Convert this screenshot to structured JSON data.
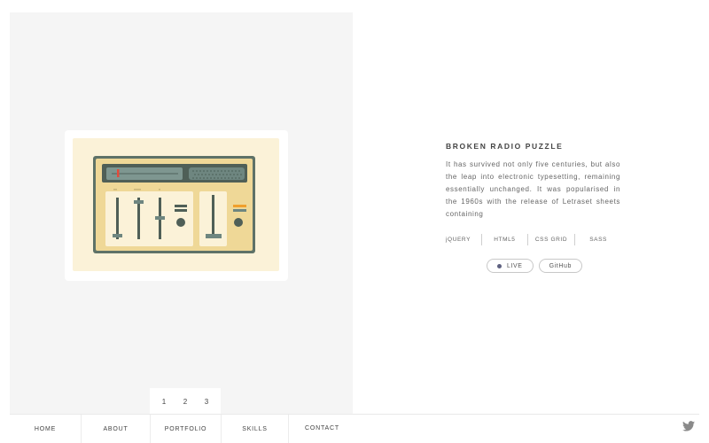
{
  "colors": {
    "panel_bg": "#f5f5f5",
    "card_bg": "#ffffff",
    "illustration_bg": "#fbf2d8",
    "radio_body": "#efd897",
    "radio_frame": "#5e7267",
    "accent_red": "#e24b3c",
    "accent_orange": "#f0a02c",
    "live_dot": "#5e6180"
  },
  "illustration": {
    "icon": "radio-illustration"
  },
  "pager": {
    "pages": [
      "1",
      "2",
      "3"
    ]
  },
  "project": {
    "title": "BROKEN RADIO PUZZLE",
    "description": "It has survived not only five centuries, but also the leap into electronic typesetting, remaining essentially unchanged. It was popularised in the 1960s with the release of Letraset sheets containing",
    "tags": [
      "jQUERY",
      "HTML5",
      "CSS GRID",
      "SASS"
    ],
    "links": {
      "live": "LIVE",
      "github": "GitHub"
    }
  },
  "nav": {
    "items": [
      "HOME",
      "ABOUT",
      "PORTFOLIO",
      "SKILLS",
      "CONTACT"
    ]
  },
  "social": {
    "icon": "twitter-icon"
  }
}
